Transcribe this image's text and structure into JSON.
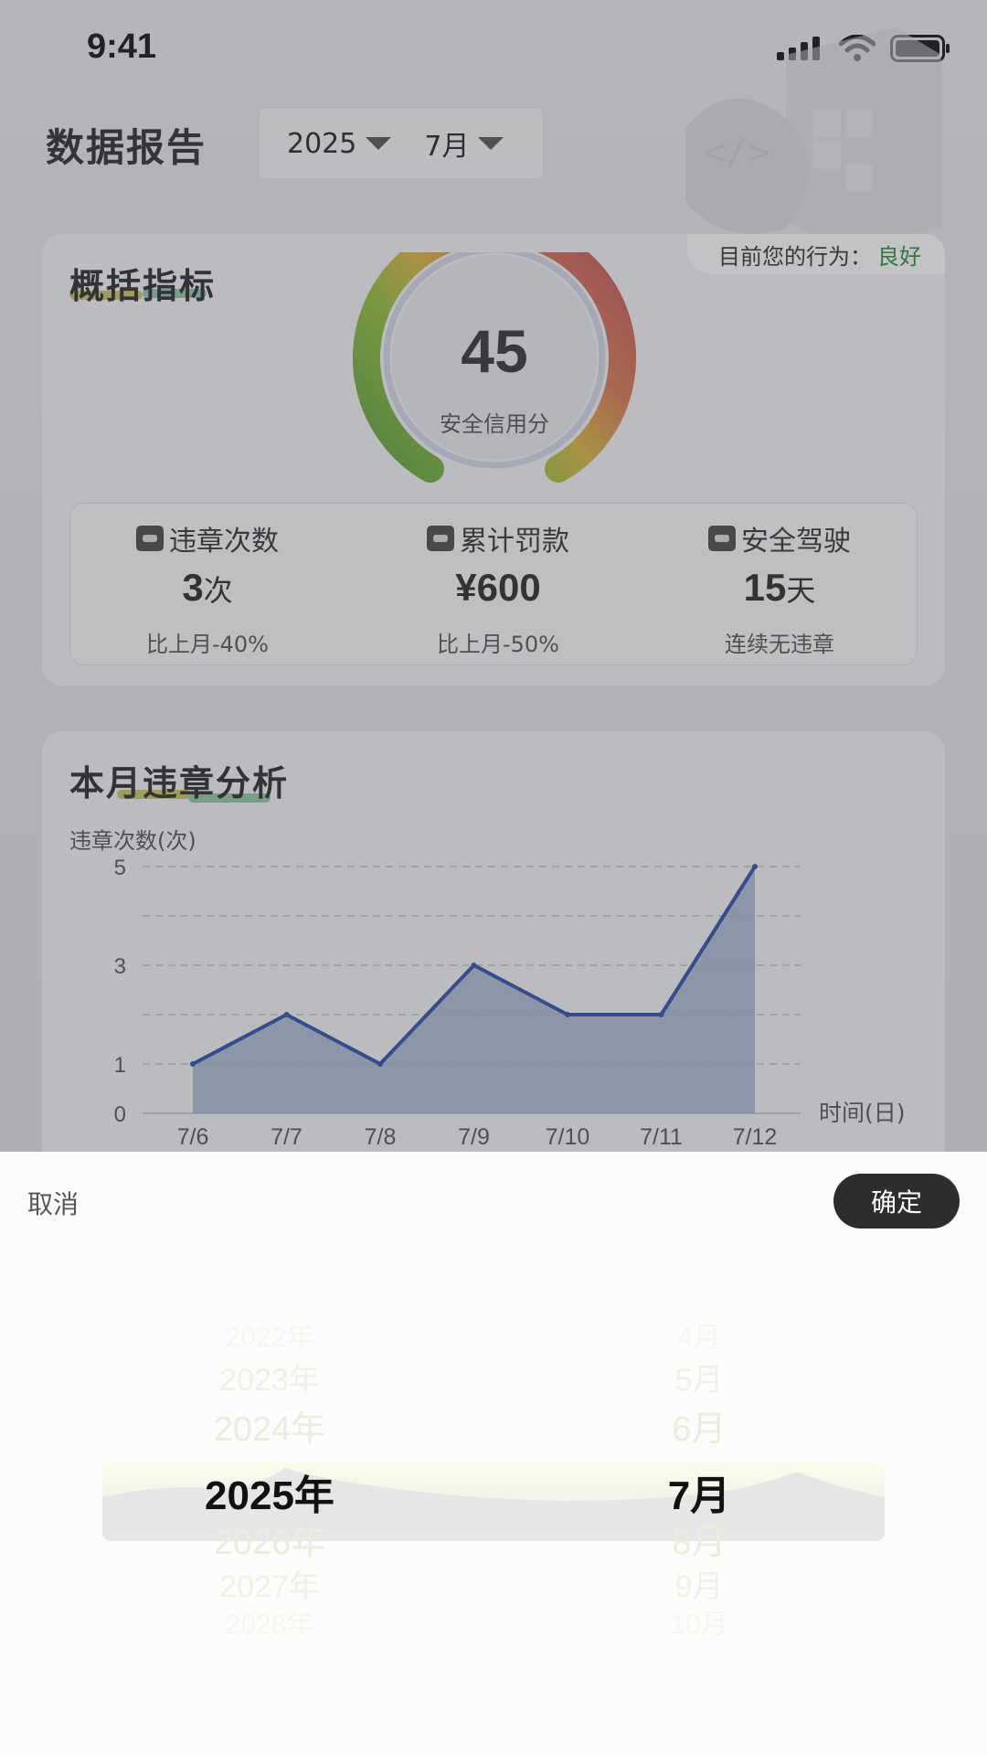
{
  "status_bar": {
    "time": "9:41"
  },
  "header": {
    "title": "数据报告",
    "year": "2025",
    "month": "7月"
  },
  "overview": {
    "title": "概括指标",
    "behavior_label": "目前您的行为：",
    "behavior_value": "良好",
    "score": "45",
    "score_label": "安全信用分",
    "stats": [
      {
        "icon": "car-icon",
        "label": "违章次数",
        "value": "3",
        "unit": "次",
        "sub": "比上月-40%"
      },
      {
        "icon": "money-bag-icon",
        "label": "累计罚款",
        "value": "¥600",
        "unit": "",
        "sub": "比上月-50%"
      },
      {
        "icon": "car-icon",
        "label": "安全驾驶",
        "value": "15",
        "unit": "天",
        "sub": "连续无违章"
      }
    ]
  },
  "analysis": {
    "title": "本月违章分析",
    "ylabel": "违章次数(次)",
    "xlabel": "时间(日)"
  },
  "chart_data": {
    "type": "area",
    "x": [
      "7/6",
      "7/7",
      "7/8",
      "7/9",
      "7/10",
      "7/11",
      "7/12"
    ],
    "values": [
      1,
      2,
      1,
      3,
      2,
      2,
      5
    ],
    "yticks": [
      0,
      1,
      3,
      5
    ],
    "ylim": [
      0,
      5
    ],
    "ylabel": "违章次数(次)",
    "xlabel": "时间(日)",
    "grid": true,
    "line_color": "#2f4fa8"
  },
  "picker": {
    "cancel_label": "取消",
    "confirm_label": "确定",
    "years": [
      "2022年",
      "2023年",
      "2024年",
      "2025年",
      "2026年",
      "2027年",
      "2028年"
    ],
    "months": [
      "4月",
      "5月",
      "6月",
      "7月",
      "8月",
      "9月",
      "10月"
    ],
    "selected_index": 3
  },
  "colors": {
    "good": "#2e8b3a",
    "confirm_bg": "#2d2d2d",
    "accent_line": "#2f4fa8"
  }
}
